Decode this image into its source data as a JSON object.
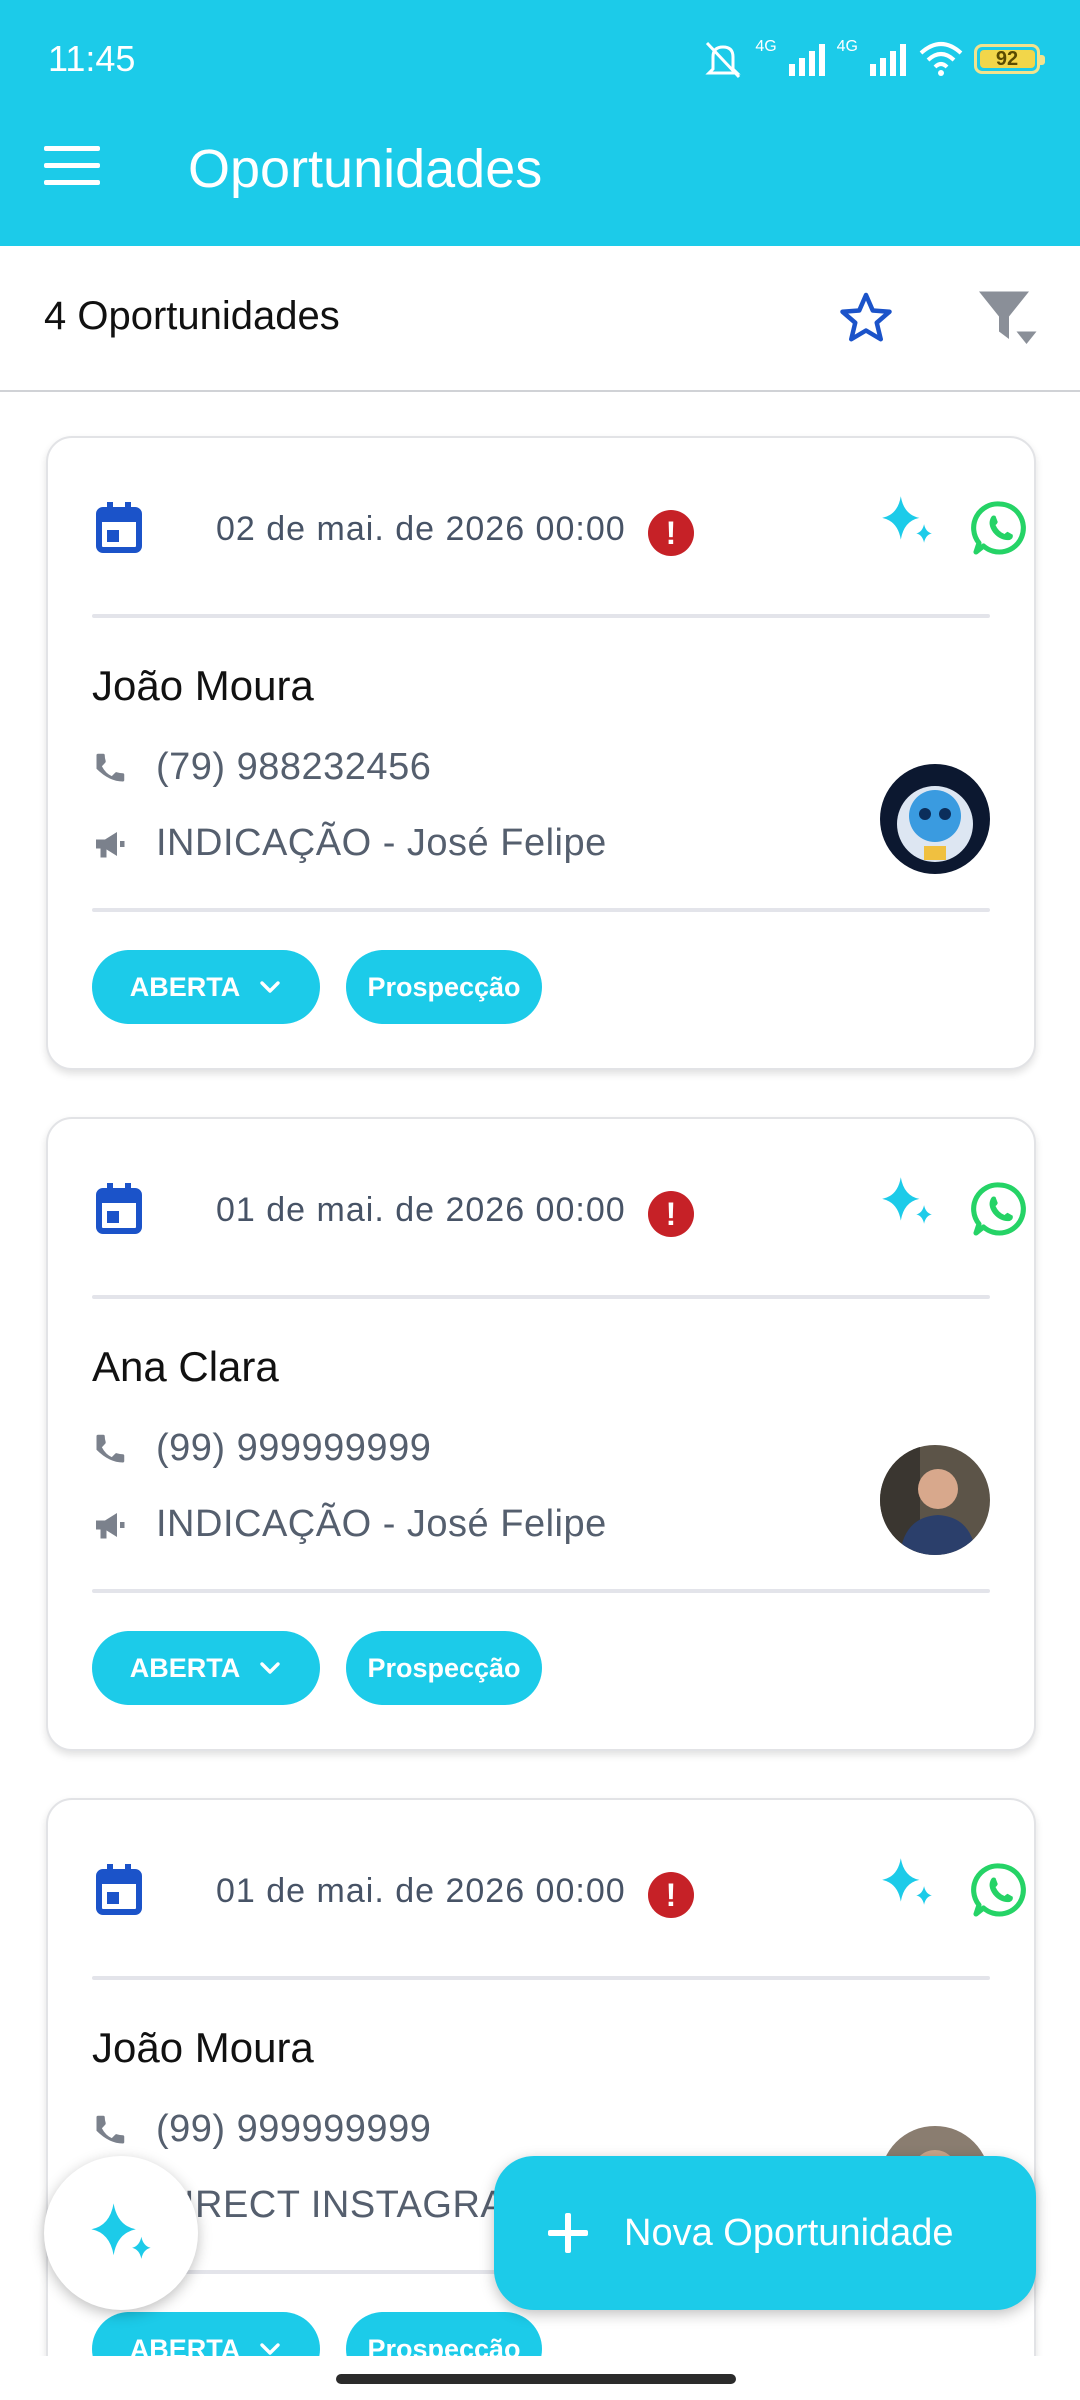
{
  "status_bar": {
    "time": "11:45",
    "network": "4G",
    "battery": "92"
  },
  "header": {
    "title": "Oportunidades"
  },
  "toolbar": {
    "count_label": "4 Oportunidades"
  },
  "cards": [
    {
      "date": "02 de mai. de 2026 00:00",
      "name": "João Moura",
      "phone": "(79) 988232456",
      "source": "INDICAÇÃO - José Felipe",
      "status": "ABERTA",
      "stage": "Prospecção"
    },
    {
      "date": "01 de mai. de 2026 00:00",
      "name": "Ana Clara",
      "phone": "(99) 999999999",
      "source": "INDICAÇÃO - José Felipe",
      "status": "ABERTA",
      "stage": "Prospecção"
    },
    {
      "date": "01 de mai. de 2026 00:00",
      "name": "João Moura",
      "phone": "(99) 999999999",
      "source": "DIRECT INSTAGRAM",
      "status": "ABERTA",
      "stage": "Prospecção"
    }
  ],
  "alert_mark": "!",
  "fab": {
    "new_label": "Nova Oportunidade"
  },
  "colors": {
    "accent": "#1ccbe9",
    "alert": "#c62127",
    "calendar": "#1b53c9",
    "whatsapp": "#25d366"
  },
  "icons": [
    "menu-icon",
    "star-icon",
    "filter-icon",
    "calendar-icon",
    "alert-icon",
    "sparkle-icon",
    "whatsapp-icon",
    "phone-icon",
    "megaphone-icon",
    "chevron-down-icon",
    "plus-icon"
  ]
}
